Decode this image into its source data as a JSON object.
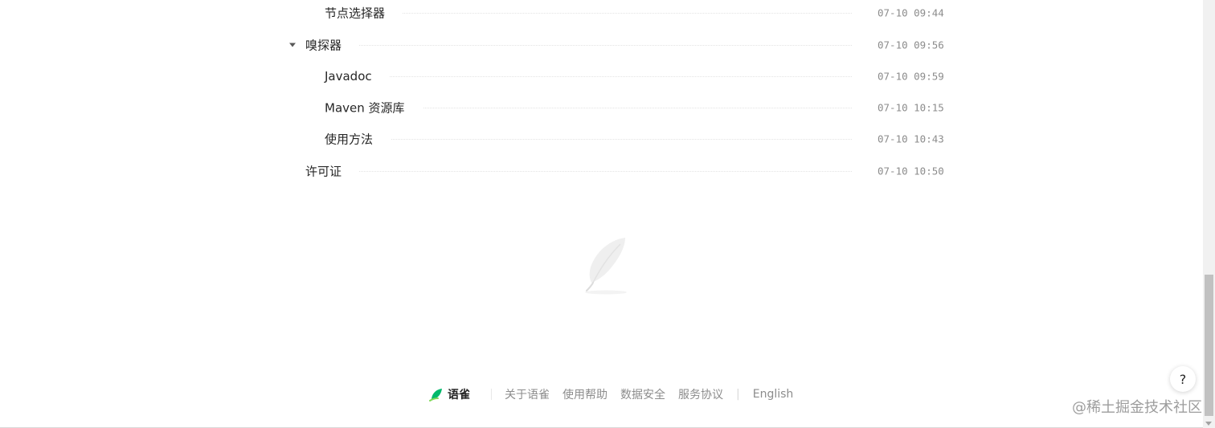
{
  "toc": [
    {
      "title": "节点选择器",
      "time": "07-10 09:44"
    },
    {
      "title": "嗅探器",
      "time": "07-10 09:56"
    },
    {
      "title": "Javadoc",
      "time": "07-10 09:59"
    },
    {
      "title": "Maven 资源库",
      "time": "07-10 10:15"
    },
    {
      "title": "使用方法",
      "time": "07-10 10:43"
    },
    {
      "title": "许可证",
      "time": "07-10 10:50"
    }
  ],
  "footer": {
    "brand": "语雀",
    "links": [
      "关于语雀",
      "使用帮助",
      "数据安全",
      "服务协议"
    ],
    "separator": "|",
    "language": "English"
  },
  "help_label": "?",
  "watermark": "@稀土掘金技术社区",
  "colors": {
    "brand_green": "#00b96b",
    "text": "#262626",
    "muted": "#8c8c8c"
  }
}
